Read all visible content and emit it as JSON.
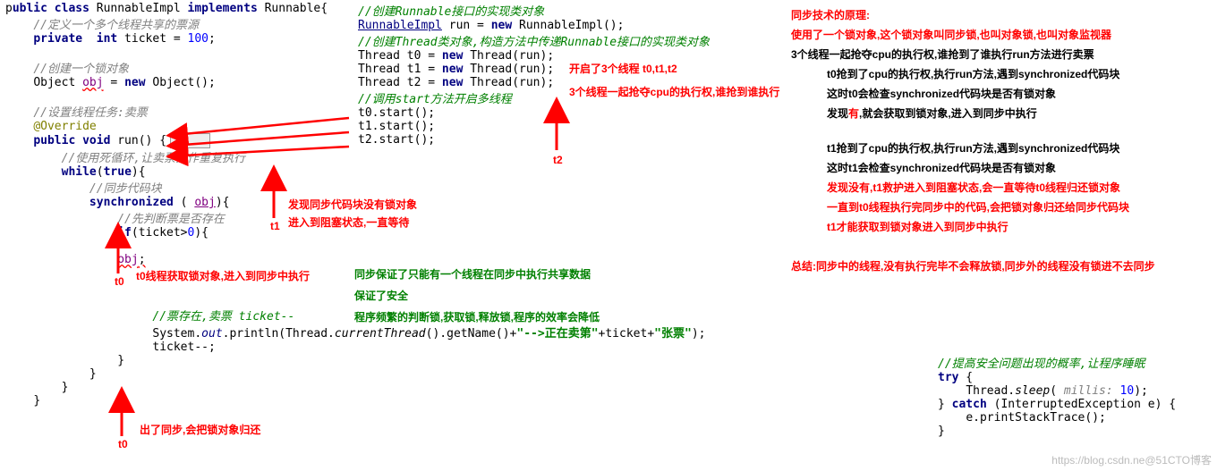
{
  "left": {
    "l1a": "p",
    "l1b": "ublic class",
    "l1c": " RunnableImpl ",
    "l1d": "implements",
    "l1e": " Runnable{",
    "l2": "//定义一个多个线程共享的票源",
    "l3a": "private  int",
    "l3b": " ticket = ",
    "l3c": "100",
    "l3d": ";",
    "l4": "//创建一个锁对象",
    "l5a": "Object ",
    "l5b": "obj",
    "l5c": " = ",
    "l5d": "new",
    "l5e": " Object();",
    "l6": "//设置线程任务:卖票",
    "l7": "@Override",
    "l8a": "public void",
    "l8b": " run() {",
    "l8c": "    ",
    "l9": "//使用死循环,让卖票操作重复执行",
    "l10a": "while",
    "l10b": "(",
    "l10c": "true",
    "l10d": "){",
    "l11": "//同步代码块",
    "l12a": "synchronized",
    "l12b": " ( ",
    "l12c": "obj",
    "l12d": "){",
    "l13": "//先判断票是否存在",
    "l14a": "if",
    "l14b": "(ticket>",
    "l14c": "0",
    "l14d": "){",
    "l15a": "obj",
    "l15b": ";",
    "l16": "//票存在,卖票 ticket--",
    "l17a": "System.",
    "l17b": "out",
    "l17c": ".println(Thread.",
    "l17d": "currentThread",
    "l17e": "().getName()+",
    "l17f": "\"-->",
    "l17g": "正在卖第\"",
    "l17h": "+ticket+",
    "l17i": "\"张票\"",
    "l17j": ");",
    "l18": "ticket--;",
    "l19": "}",
    "l20": "}",
    "l21": "}",
    "l22": "}"
  },
  "mid": {
    "m1": "//创建Runnable接口的实现类对象",
    "m2a": "RunnableImpl",
    "m2b": " run = ",
    "m2c": "new",
    "m2d": " RunnableImpl();",
    "m3": "//创建Thread类对象,构造方法中传递Runnable接口的实现类对象",
    "m4a": "Thread t0 = ",
    "m4b": "new",
    "m4c": " Thread(run);",
    "m5a": "Thread t1 = ",
    "m5b": "new",
    "m5c": " Thread(run);",
    "m6a": "Thread t2 = ",
    "m6b": "new",
    "m6c": " Thread(run);",
    "m7": "//调用start方法开启多线程",
    "m8": "t0.start();",
    "m9": "t1.start();",
    "m10": "t2.start();"
  },
  "ann": {
    "a1": "开启了3个线程 t0,t1,t2",
    "a2": "3个线程一起抢夺cpu的执行权,谁抢到谁执行",
    "t0": "t0",
    "t1": "t1",
    "t2": "t2",
    "a3": "发现同步代码块没有锁对象",
    "a4": "进入到阻塞状态,一直等待",
    "a5": "t0线程获取锁对象,进入到同步中执行",
    "a6": "同步保证了只能有一个线程在同步中执行共享数据",
    "a7": "保证了安全",
    "a8": "程序频繁的判断锁,获取锁,释放锁,程序的效率会降低",
    "a9": "出了同步,会把锁对象归还"
  },
  "right": {
    "r1": "同步技术的原理:",
    "r2": "使用了一个锁对象,这个锁对象叫同步锁,也叫对象锁,也叫对象监视器",
    "r3": "3个线程一起抢夺cpu的执行权,谁抢到了谁执行run方法进行卖票",
    "r4": "t0抢到了cpu的执行权,执行run方法,遇到synchronized代码块",
    "r5": "这时t0会检查synchronized代码块是否有锁对象",
    "r6a": "发现",
    "r6b": "有",
    "r6c": ",就会获取到锁对象,进入到同步中执行",
    "r7": "t1抢到了cpu的执行权,执行run方法,遇到synchronized代码块",
    "r8": "这时t1会检查synchronized代码块是否有锁对象",
    "r9": "发现没有,t1救护进入到阻塞状态,会一直等待t0线程归还锁对象",
    "r10": "一直到t0线程执行完同步中的代码,会把锁对象归还给同步代码块",
    "r11": "t1才能获取到锁对象进入到同步中执行",
    "r12": "总结:同步中的线程,没有执行完毕不会释放锁,同步外的线程没有锁进不去同步"
  },
  "bottom": {
    "b1": "//提高安全问题出现的概率,让程序睡眠",
    "b2a": "try",
    "b2b": " {",
    "b3a": "Thread.",
    "b3b": "sleep",
    "b3c": "( ",
    "b3d": "millis:",
    "b3e": " 10",
    "b3f": ");",
    "b4a": "} ",
    "b4b": "catch",
    "b4c": " (InterruptedException e) {",
    "b5": "e.printStackTrace();",
    "b6": "}"
  },
  "watermark": "https://blog.csdn.ne@51CTO博客"
}
